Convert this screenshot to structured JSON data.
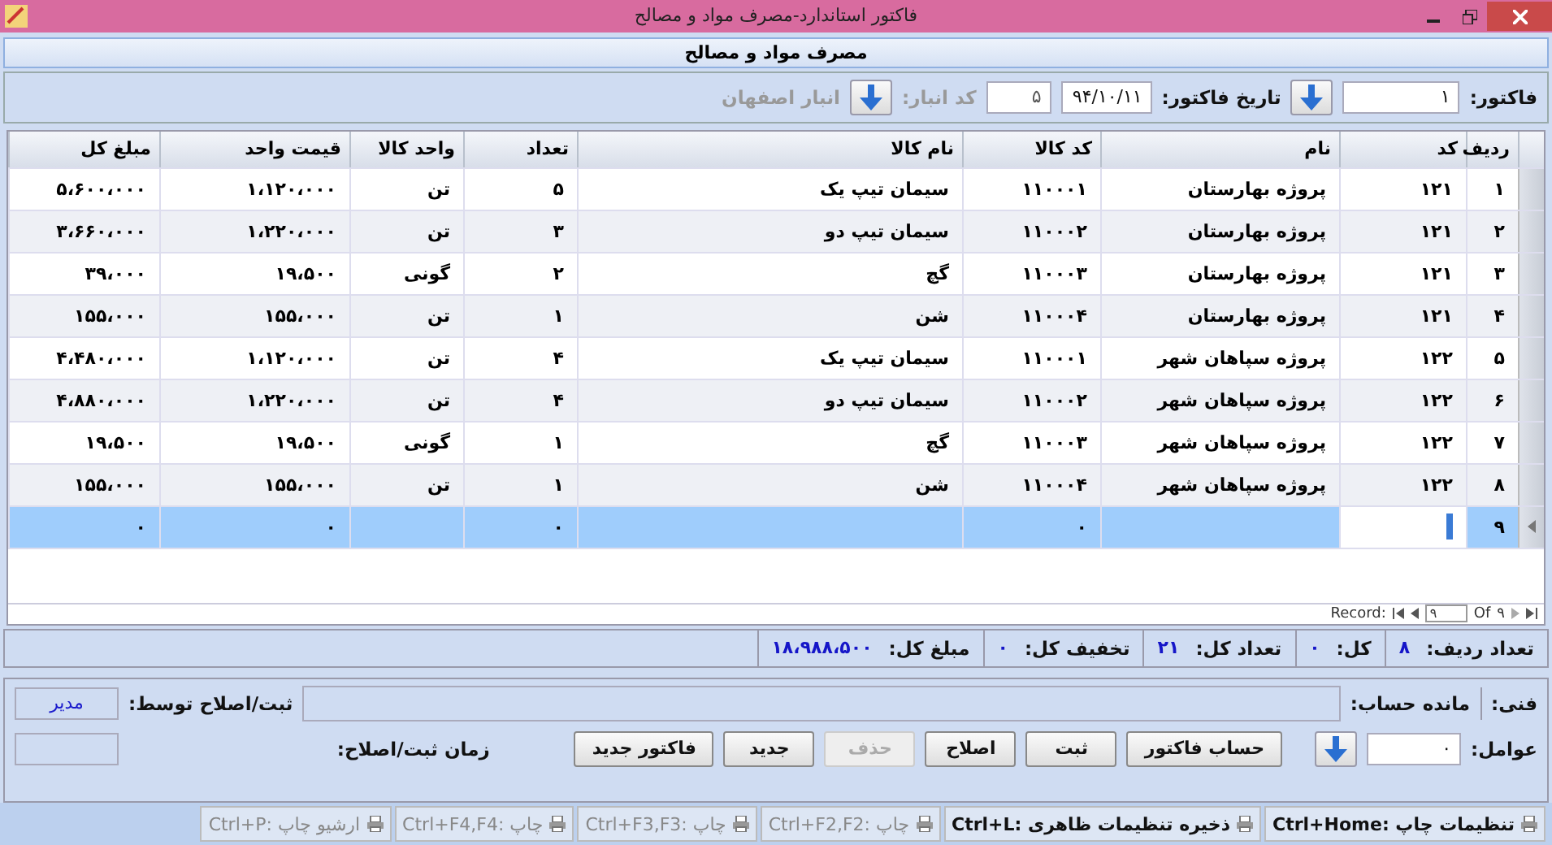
{
  "window": {
    "title": "فاکتور استاندارد-مصرف مواد و مصالح"
  },
  "form_title": "مصرف مواد و مصالح",
  "header": {
    "invoice_label": "فاکتور:",
    "invoice_value": "۱",
    "date_label": "تاریخ فاکتور:",
    "date_value": "۹۴/۱۰/۱۱",
    "warehouse_code_value": "۵",
    "warehouse_code_label": "کد انبار:",
    "warehouse_name": "انبار اصفهان",
    "warehouse_disabled": true
  },
  "table": {
    "columns": [
      "ردیف",
      "کد",
      "نام",
      "کد کالا",
      "نام کالا",
      "تعداد",
      "واحد کالا",
      "قیمت واحد",
      "مبلغ کل"
    ],
    "rows": [
      {
        "selected": false,
        "cells": [
          "۱",
          "۱۲۱",
          "پروژه بهارستان",
          "۱۱۰۰۰۱",
          "سیمان تیپ یک",
          "۵",
          "تن",
          "۱،۱۲۰،۰۰۰",
          "۵،۶۰۰،۰۰۰"
        ]
      },
      {
        "selected": false,
        "cells": [
          "۲",
          "۱۲۱",
          "پروژه بهارستان",
          "۱۱۰۰۰۲",
          "سیمان تیپ دو",
          "۳",
          "تن",
          "۱،۲۲۰،۰۰۰",
          "۳،۶۶۰،۰۰۰"
        ]
      },
      {
        "selected": false,
        "cells": [
          "۳",
          "۱۲۱",
          "پروژه بهارستان",
          "۱۱۰۰۰۳",
          "گچ",
          "۲",
          "گونی",
          "۱۹،۵۰۰",
          "۳۹،۰۰۰"
        ]
      },
      {
        "selected": false,
        "cells": [
          "۴",
          "۱۲۱",
          "پروژه بهارستان",
          "۱۱۰۰۰۴",
          "شن",
          "۱",
          "تن",
          "۱۵۵،۰۰۰",
          "۱۵۵،۰۰۰"
        ]
      },
      {
        "selected": false,
        "cells": [
          "۵",
          "۱۲۲",
          "پروژه سپاهان شهر",
          "۱۱۰۰۰۱",
          "سیمان تیپ یک",
          "۴",
          "تن",
          "۱،۱۲۰،۰۰۰",
          "۴،۴۸۰،۰۰۰"
        ]
      },
      {
        "selected": false,
        "cells": [
          "۶",
          "۱۲۲",
          "پروژه سپاهان شهر",
          "۱۱۰۰۰۲",
          "سیمان تیپ دو",
          "۴",
          "تن",
          "۱،۲۲۰،۰۰۰",
          "۴،۸۸۰،۰۰۰"
        ]
      },
      {
        "selected": false,
        "cells": [
          "۷",
          "۱۲۲",
          "پروژه سپاهان شهر",
          "۱۱۰۰۰۳",
          "گچ",
          "۱",
          "گونی",
          "۱۹،۵۰۰",
          "۱۹،۵۰۰"
        ]
      },
      {
        "selected": false,
        "cells": [
          "۸",
          "۱۲۲",
          "پروژه سپاهان شهر",
          "۱۱۰۰۰۴",
          "شن",
          "۱",
          "تن",
          "۱۵۵،۰۰۰",
          "۱۵۵،۰۰۰"
        ]
      },
      {
        "selected": true,
        "cells": [
          "۹",
          null,
          null,
          "۰",
          null,
          "۰",
          null,
          "۰",
          "۰"
        ]
      }
    ]
  },
  "record_nav": {
    "label": "Record:",
    "current": "۹",
    "of": "Of",
    "total": "۹"
  },
  "totals": [
    {
      "label": "تعداد ردیف:",
      "value": "۸"
    },
    {
      "label": "کل:",
      "value": "۰"
    },
    {
      "label": "تعداد کل:",
      "value": "۲۱"
    },
    {
      "label": "تخفیف کل:",
      "value": "۰"
    },
    {
      "label": "مبلغ کل:",
      "value": "۱۸،۹۸۸،۵۰۰"
    }
  ],
  "footer": {
    "tech_label": "فنی:",
    "balance_label": "مانده حساب:",
    "agents_label": "عوامل:",
    "agents_value": "۰",
    "recorded_by_label": "ثبت/اصلاح توسط:",
    "recorded_by_value": "مدیر",
    "record_time_label": "زمان ثبت/اصلاح:"
  },
  "buttons": [
    {
      "label": "حساب فاکتور",
      "disabled": false
    },
    {
      "label": "ثبت",
      "disabled": false
    },
    {
      "label": "اصلاح",
      "disabled": false
    },
    {
      "label": "حذف",
      "disabled": true
    },
    {
      "label": "جدید",
      "disabled": false
    },
    {
      "label": "فاکتور جدید",
      "disabled": false
    }
  ],
  "status_bar": [
    {
      "label": "تنظیمات چاپ :Ctrl+Home",
      "disabled": false
    },
    {
      "label": "ذخیره تنظیمات ظاهری :Ctrl+L",
      "disabled": false
    },
    {
      "label": "چاپ :Ctrl+F2,F2",
      "disabled": true
    },
    {
      "label": "چاپ :Ctrl+F3,F3",
      "disabled": true
    },
    {
      "label": "چاپ :Ctrl+F4,F4",
      "disabled": true
    },
    {
      "label": "ارشیو چاپ :Ctrl+P",
      "disabled": true
    }
  ]
}
